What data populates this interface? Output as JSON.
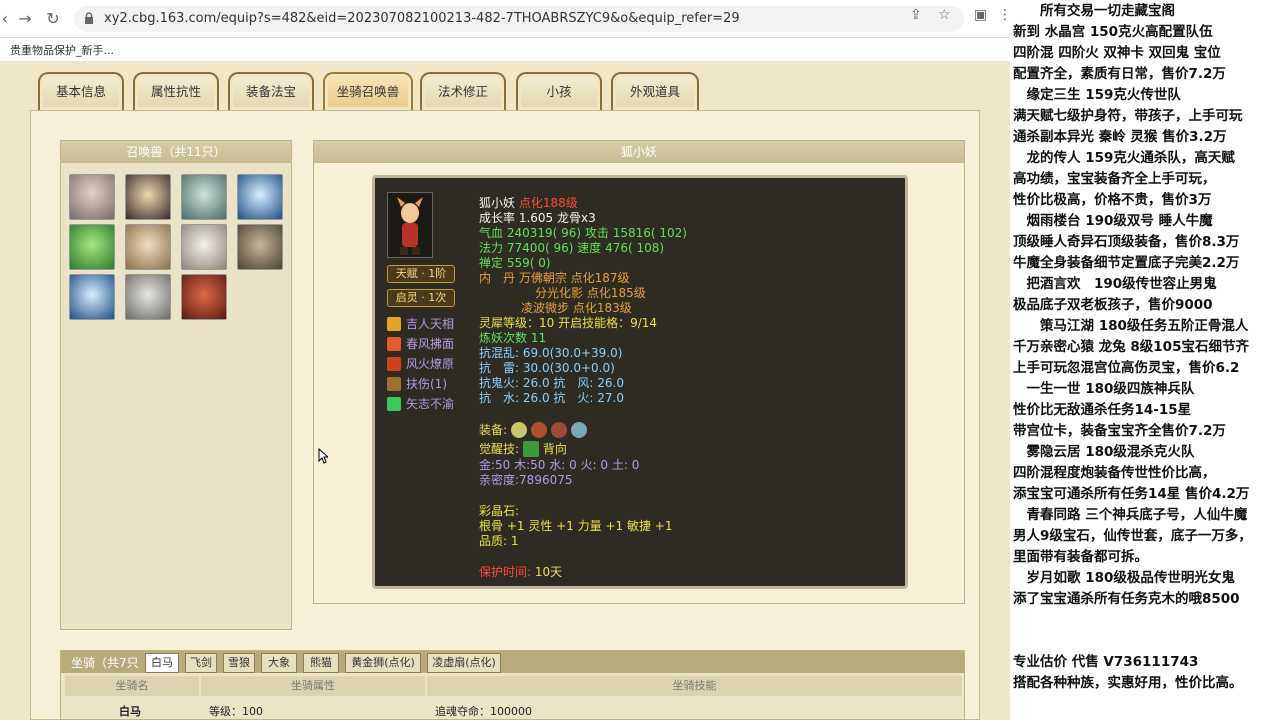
{
  "browser": {
    "url": "xy2.cbg.163.com/equip?s=482&eid=202307082100213-482-7THOABRSZYC9&o&equip_refer=29",
    "bookmark": "贵重物品保护_新手..."
  },
  "tabs": [
    "基本信息",
    "属性抗性",
    "装备法宝",
    "坐骑召唤兽",
    "法术修正",
    "小孩",
    "外观道具"
  ],
  "pets_panel": {
    "title": "召唤兽（共11只）"
  },
  "pet_detail": {
    "title": "狐小妖",
    "name": "狐小妖",
    "tag": "点化188级",
    "line_growth": "成长率 1.605 龙骨x3",
    "line_hp": "气血 240319( 96) 攻击 15816( 102)",
    "line_mp": "法力 77400( 96) 速度 476( 108)",
    "line_zen": "禅定 559( 0)",
    "line_dan1": "内　丹 万佛朝宗 点化187级",
    "line_dan2": "分光化影 点化185级",
    "line_dan3": "凌波微步 点化183级",
    "line_soul": "灵犀等级：10 开启技能格：9/14",
    "line_lian": "炼妖次数 11",
    "line_kh": "抗混乱: 69.0(30.0+39.0)",
    "line_kl": "抗　雷: 30.0(30.0+0.0)",
    "line_kg": "抗鬼火: 26.0 抗　风: 26.0",
    "line_ks": "抗　水: 26.0 抗　火: 27.0",
    "badge1": "天赋 · 1阶",
    "badge2": "启灵 · 1次",
    "skills": [
      "吉人天相",
      "春风拂面",
      "风火燎原",
      "扶伤(1)",
      "矢志不渝"
    ],
    "equip_label": "装备:",
    "awaken_label": "觉醒技:",
    "awaken_skill": "背向",
    "line_elements": "金:50 木:50 水: 0 火: 0 土: 0",
    "line_intimacy": "亲密度:7896075",
    "crystal_label": "彩晶石:",
    "crystal_line": "根骨 +1 灵性 +1 力量 +1 敏捷 +1",
    "crystal_quality": "品质: 1",
    "protect_label": "保护时间:",
    "protect_value": "10天"
  },
  "mount": {
    "title": "坐骑（共7只",
    "tabs": [
      "白马",
      "飞剑",
      "雪狼",
      "大象",
      "熊猫",
      "黄金狮(点化)",
      "凌虚扇(点化)"
    ],
    "col1": "坐骑名",
    "col2": "坐骑属性",
    "col3": "坐骑技能",
    "name": "白马",
    "level": "等级：100",
    "skill": "追魂夺命：100000"
  },
  "sidebar": [
    "　　所有交易一切走藏宝阁",
    "新到 水晶宫 150克火高配置队伍",
    "四阶混 四阶火 双神卡 双回鬼 宝位",
    "配置齐全，素质有日常，售价7.2万",
    "　缘定三生 159克火传世队",
    "满天赋七级护身符，带孩子，上手可玩",
    "通杀副本异光 秦岭 灵猴 售价3.2万",
    "　龙的传人 159克火通杀队，高天赋",
    "高功绩，宝宝装备齐全上手可玩，",
    "性价比极高，价格不贵，售价3万",
    "　烟雨楼台 190级双号 睡人牛魔",
    "顶级睡人奇异石顶级装备，售价8.3万",
    "牛魔全身装备细节定置底子完美2.2万",
    "　把酒言欢　190级传世容止男鬼",
    "极品底子双老板孩子，售价9000",
    "　　策马江湖 180级任务五阶正骨混人",
    "千万亲密心猿 龙兔 8级105宝石细节齐",
    "上手可玩忽混宫位高伤灵宝，售价6.2",
    "　一生一世 180级四族神兵队",
    "性价比无敌通杀任务14-15星",
    "带宫位卡，装备宝宝齐全售价7.2万",
    "　雾隐云居 180级混杀克火队",
    "四阶混程度炮装备传世性价比高，",
    "添宝宝可通杀所有任务14星 售价4.2万",
    "　青春同路 三个神兵底子号，人仙牛魔",
    "男人9级宝石，仙传世套，底子一万多，",
    "里面带有装备都可拆。",
    "　岁月如歌 180级极品传世明光女鬼",
    "添了宝宝通杀所有任务克木的哦8500",
    "",
    "",
    "专业估价 代售 V736111743",
    "搭配各种种族，实惠好用，性价比高。"
  ]
}
